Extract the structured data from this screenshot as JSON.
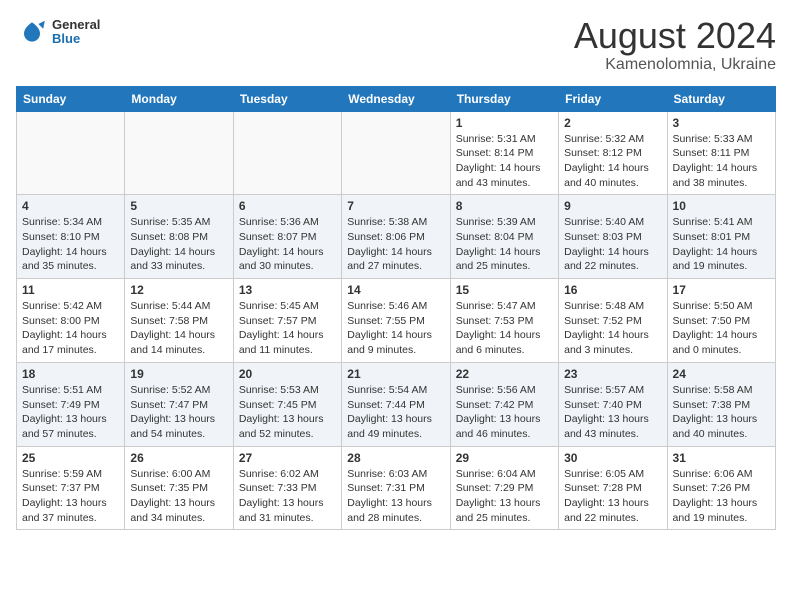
{
  "header": {
    "logo": {
      "general": "General",
      "blue": "Blue"
    },
    "title": "August 2024",
    "subtitle": "Kamenolomnia, Ukraine"
  },
  "weekdays": [
    "Sunday",
    "Monday",
    "Tuesday",
    "Wednesday",
    "Thursday",
    "Friday",
    "Saturday"
  ],
  "weeks": [
    [
      {
        "day": "",
        "info": ""
      },
      {
        "day": "",
        "info": ""
      },
      {
        "day": "",
        "info": ""
      },
      {
        "day": "",
        "info": ""
      },
      {
        "day": "1",
        "info": "Sunrise: 5:31 AM\nSunset: 8:14 PM\nDaylight: 14 hours\nand 43 minutes."
      },
      {
        "day": "2",
        "info": "Sunrise: 5:32 AM\nSunset: 8:12 PM\nDaylight: 14 hours\nand 40 minutes."
      },
      {
        "day": "3",
        "info": "Sunrise: 5:33 AM\nSunset: 8:11 PM\nDaylight: 14 hours\nand 38 minutes."
      }
    ],
    [
      {
        "day": "4",
        "info": "Sunrise: 5:34 AM\nSunset: 8:10 PM\nDaylight: 14 hours\nand 35 minutes."
      },
      {
        "day": "5",
        "info": "Sunrise: 5:35 AM\nSunset: 8:08 PM\nDaylight: 14 hours\nand 33 minutes."
      },
      {
        "day": "6",
        "info": "Sunrise: 5:36 AM\nSunset: 8:07 PM\nDaylight: 14 hours\nand 30 minutes."
      },
      {
        "day": "7",
        "info": "Sunrise: 5:38 AM\nSunset: 8:06 PM\nDaylight: 14 hours\nand 27 minutes."
      },
      {
        "day": "8",
        "info": "Sunrise: 5:39 AM\nSunset: 8:04 PM\nDaylight: 14 hours\nand 25 minutes."
      },
      {
        "day": "9",
        "info": "Sunrise: 5:40 AM\nSunset: 8:03 PM\nDaylight: 14 hours\nand 22 minutes."
      },
      {
        "day": "10",
        "info": "Sunrise: 5:41 AM\nSunset: 8:01 PM\nDaylight: 14 hours\nand 19 minutes."
      }
    ],
    [
      {
        "day": "11",
        "info": "Sunrise: 5:42 AM\nSunset: 8:00 PM\nDaylight: 14 hours\nand 17 minutes."
      },
      {
        "day": "12",
        "info": "Sunrise: 5:44 AM\nSunset: 7:58 PM\nDaylight: 14 hours\nand 14 minutes."
      },
      {
        "day": "13",
        "info": "Sunrise: 5:45 AM\nSunset: 7:57 PM\nDaylight: 14 hours\nand 11 minutes."
      },
      {
        "day": "14",
        "info": "Sunrise: 5:46 AM\nSunset: 7:55 PM\nDaylight: 14 hours\nand 9 minutes."
      },
      {
        "day": "15",
        "info": "Sunrise: 5:47 AM\nSunset: 7:53 PM\nDaylight: 14 hours\nand 6 minutes."
      },
      {
        "day": "16",
        "info": "Sunrise: 5:48 AM\nSunset: 7:52 PM\nDaylight: 14 hours\nand 3 minutes."
      },
      {
        "day": "17",
        "info": "Sunrise: 5:50 AM\nSunset: 7:50 PM\nDaylight: 14 hours\nand 0 minutes."
      }
    ],
    [
      {
        "day": "18",
        "info": "Sunrise: 5:51 AM\nSunset: 7:49 PM\nDaylight: 13 hours\nand 57 minutes."
      },
      {
        "day": "19",
        "info": "Sunrise: 5:52 AM\nSunset: 7:47 PM\nDaylight: 13 hours\nand 54 minutes."
      },
      {
        "day": "20",
        "info": "Sunrise: 5:53 AM\nSunset: 7:45 PM\nDaylight: 13 hours\nand 52 minutes."
      },
      {
        "day": "21",
        "info": "Sunrise: 5:54 AM\nSunset: 7:44 PM\nDaylight: 13 hours\nand 49 minutes."
      },
      {
        "day": "22",
        "info": "Sunrise: 5:56 AM\nSunset: 7:42 PM\nDaylight: 13 hours\nand 46 minutes."
      },
      {
        "day": "23",
        "info": "Sunrise: 5:57 AM\nSunset: 7:40 PM\nDaylight: 13 hours\nand 43 minutes."
      },
      {
        "day": "24",
        "info": "Sunrise: 5:58 AM\nSunset: 7:38 PM\nDaylight: 13 hours\nand 40 minutes."
      }
    ],
    [
      {
        "day": "25",
        "info": "Sunrise: 5:59 AM\nSunset: 7:37 PM\nDaylight: 13 hours\nand 37 minutes."
      },
      {
        "day": "26",
        "info": "Sunrise: 6:00 AM\nSunset: 7:35 PM\nDaylight: 13 hours\nand 34 minutes."
      },
      {
        "day": "27",
        "info": "Sunrise: 6:02 AM\nSunset: 7:33 PM\nDaylight: 13 hours\nand 31 minutes."
      },
      {
        "day": "28",
        "info": "Sunrise: 6:03 AM\nSunset: 7:31 PM\nDaylight: 13 hours\nand 28 minutes."
      },
      {
        "day": "29",
        "info": "Sunrise: 6:04 AM\nSunset: 7:29 PM\nDaylight: 13 hours\nand 25 minutes."
      },
      {
        "day": "30",
        "info": "Sunrise: 6:05 AM\nSunset: 7:28 PM\nDaylight: 13 hours\nand 22 minutes."
      },
      {
        "day": "31",
        "info": "Sunrise: 6:06 AM\nSunset: 7:26 PM\nDaylight: 13 hours\nand 19 minutes."
      }
    ]
  ]
}
